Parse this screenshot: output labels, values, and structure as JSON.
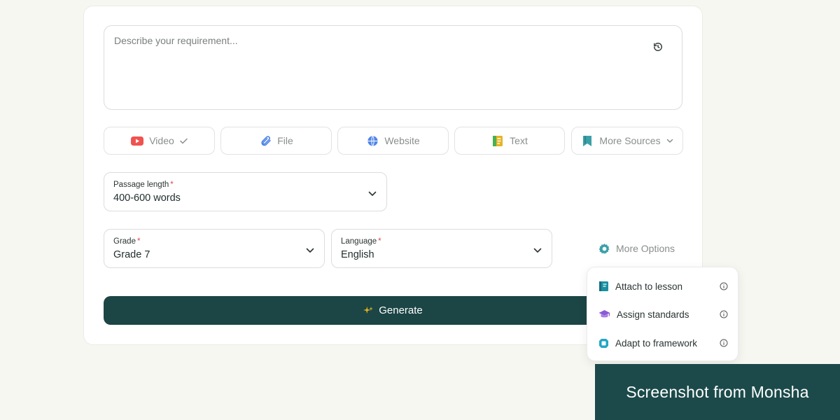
{
  "prompt": {
    "placeholder": "Describe your requirement...",
    "history_icon": "history-icon"
  },
  "sources": [
    {
      "label": "Video",
      "icon": "youtube-icon",
      "color": "#ef5350",
      "dropdown": "check"
    },
    {
      "label": "File",
      "icon": "paperclip-icon",
      "color": "#4f86e6"
    },
    {
      "label": "Website",
      "icon": "globe-icon",
      "color": "#4f86e6"
    },
    {
      "label": "Text",
      "icon": "text-document-icon",
      "color": "#e6b422"
    },
    {
      "label": "More Sources",
      "icon": "bookmark-icon",
      "color": "#3aa0a8",
      "dropdown": "chevron"
    }
  ],
  "passage_length": {
    "label": "Passage length",
    "value": "400-600 words"
  },
  "grade": {
    "label": "Grade",
    "value": "Grade 7"
  },
  "language": {
    "label": "Language",
    "value": "English"
  },
  "more_options": {
    "label": "More Options",
    "icon": "gear-icon",
    "color": "#3aa0a8"
  },
  "generate": {
    "label": "Generate",
    "icon": "sparkle-icon",
    "icon_color": "#e6b422",
    "bg": "#1c4545"
  },
  "options_menu": [
    {
      "label": "Attach to lesson",
      "icon": "book-icon",
      "color": "#1b8ea1"
    },
    {
      "label": "Assign standards",
      "icon": "graduation-cap-icon",
      "color": "#8c5ad6"
    },
    {
      "label": "Adapt to framework",
      "icon": "framework-icon",
      "color": "#22a6c6"
    }
  ],
  "banner": {
    "text": "Screenshot from Monsha"
  },
  "colors": {
    "required": "#e0474c",
    "accent": "#1c4545"
  }
}
